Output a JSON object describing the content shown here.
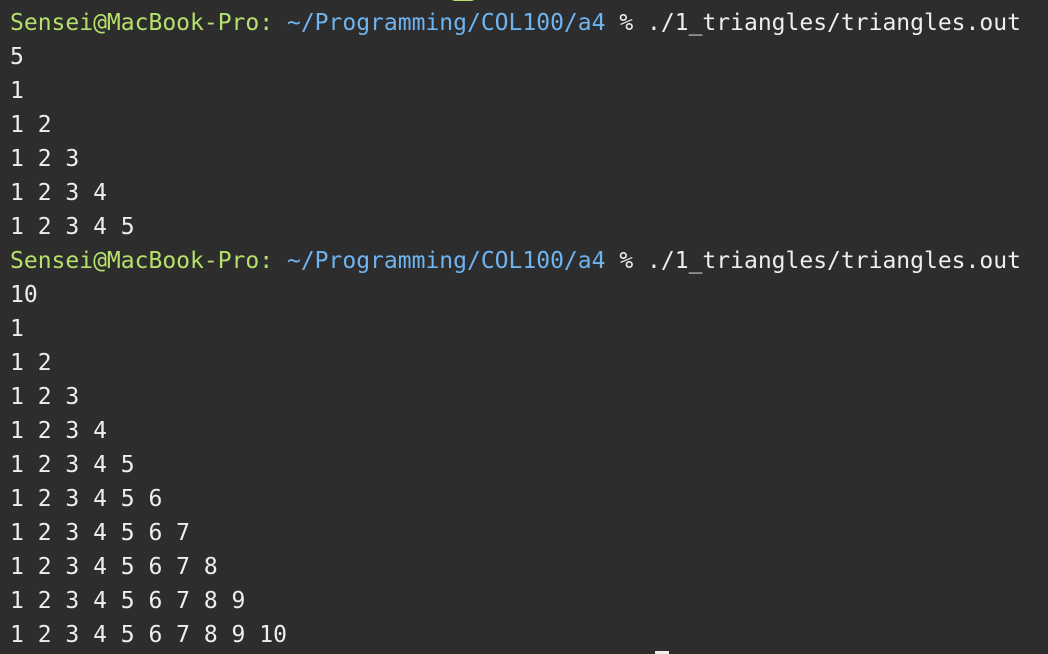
{
  "blocks": [
    {
      "prompt": {
        "user": "Sensei@MacBook-Pro:",
        "path": "~/Programming/COL100/a4",
        "symbol": "%",
        "command": "./1_triangles/triangles.out"
      },
      "input": "5",
      "output": [
        "1",
        "1 2",
        "1 2 3",
        "1 2 3 4",
        "1 2 3 4 5"
      ]
    },
    {
      "prompt": {
        "user": "Sensei@MacBook-Pro:",
        "path": "~/Programming/COL100/a4",
        "symbol": "%",
        "command": "./1_triangles/triangles.out"
      },
      "input": "10",
      "output": [
        "1",
        "1 2",
        "1 2 3",
        "1 2 3 4",
        "1 2 3 4 5",
        "1 2 3 4 5 6",
        "1 2 3 4 5 6 7",
        "1 2 3 4 5 6 7 8",
        "1 2 3 4 5 6 7 8 9",
        "1 2 3 4 5 6 7 8 9 10"
      ]
    }
  ]
}
